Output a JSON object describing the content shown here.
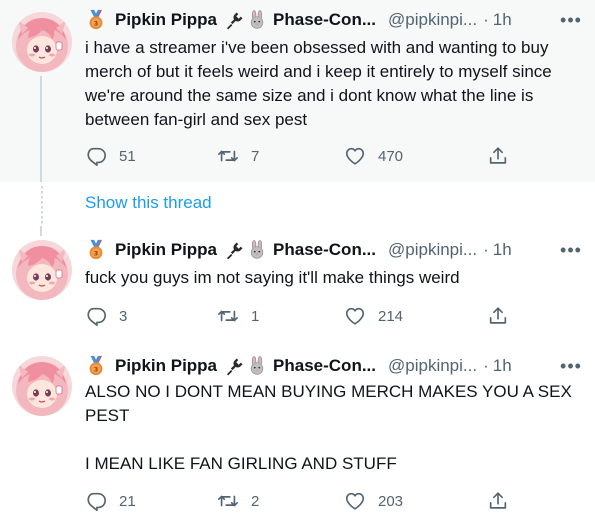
{
  "tweets": [
    {
      "display_name": "Pipkin Pippa",
      "second_name": "Phase-Con...",
      "handle": "@pipkinpi...",
      "dot": "·",
      "time": "1h",
      "text": "i have a streamer i've been obsessed with and wanting to buy merch of but it feels weird and i keep it entirely to myself since we're around the same size and i dont know what the line is between fan-girl and sex pest",
      "replies": "51",
      "retweets": "7",
      "likes": "470"
    },
    {
      "display_name": "Pipkin Pippa",
      "second_name": "Phase-Con...",
      "handle": "@pipkinpi...",
      "dot": "·",
      "time": "1h",
      "text": "fuck you guys im not saying it'll make things weird",
      "replies": "3",
      "retweets": "1",
      "likes": "214"
    },
    {
      "display_name": "Pipkin Pippa",
      "second_name": "Phase-Con...",
      "handle": "@pipkinpi...",
      "dot": "·",
      "time": "1h",
      "text": "ALSO NO I DONT MEAN BUYING MERCH MAKES YOU A SEX PEST\n\nI MEAN LIKE FAN GIRLING AND STUFF",
      "replies": "21",
      "retweets": "2",
      "likes": "203"
    }
  ],
  "show_thread_label": "Show this thread",
  "icons": {
    "medal": "medal-icon",
    "plug": "plug-icon",
    "rabbit": "rabbit-icon",
    "reply": "reply-icon",
    "retweet": "retweet-icon",
    "like": "heart-icon",
    "share": "share-icon",
    "more": "more-icon"
  },
  "colors": {
    "link": "#1d9bf0",
    "muted": "#536471",
    "text": "#0f1419",
    "highlight_bg": "#f7f9f9",
    "avatar_pink": "#f6c4c9"
  }
}
